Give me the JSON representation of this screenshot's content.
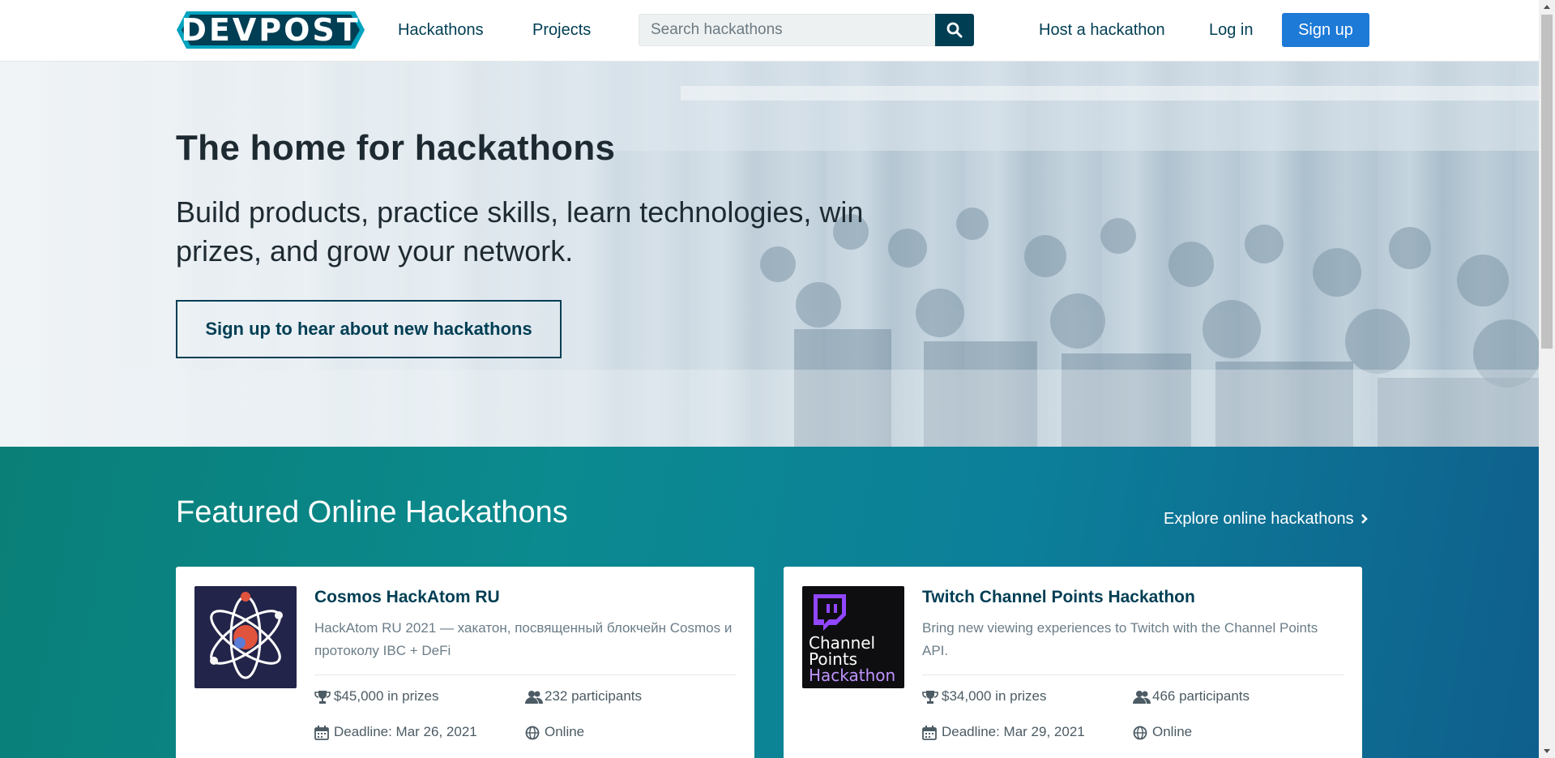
{
  "nav": {
    "logo_text": "DEVPOST",
    "hackathons": "Hackathons",
    "projects": "Projects",
    "search_placeholder": "Search hackathons",
    "host": "Host a hackathon",
    "login": "Log in",
    "signup": "Sign up"
  },
  "hero": {
    "title": "The home for hackathons",
    "subtitle": "Build products, practice skills, learn technologies, win prizes, and grow your network.",
    "cta": "Sign up to hear about new hackathons"
  },
  "featured": {
    "title": "Featured Online Hackathons",
    "explore": "Explore online hackathons",
    "cards": [
      {
        "title": "Cosmos HackAtom RU",
        "description": "HackAtom RU 2021 — хакатон, посвященный блокчейн Cosmos и протоколу IBC + DeFi",
        "prizes": "$45,000 in prizes",
        "participants": "232 participants",
        "deadline": "Deadline: Mar 26, 2021",
        "location": "Online"
      },
      {
        "title": "Twitch Channel Points Hackathon",
        "description": "Bring new viewing experiences to Twitch with the Channel Points API.",
        "prizes": "$34,000 in prizes",
        "participants": "466 participants",
        "deadline": "Deadline: Mar 29, 2021",
        "location": "Online",
        "thumb_lines": [
          "Channel",
          "Points",
          "Hackathon"
        ]
      }
    ]
  },
  "colors": {
    "brand_dark": "#003e54",
    "logo_accent": "#00a3bf",
    "primary_button": "#1d7ad7",
    "twitch_purple": "#9146ff",
    "teal_band": "#0b8a8f"
  },
  "icons": [
    "search-icon",
    "chevron-right-icon",
    "trophy-icon",
    "users-icon",
    "calendar-icon",
    "globe-icon",
    "twitch-logo-icon",
    "atom-icon"
  ]
}
